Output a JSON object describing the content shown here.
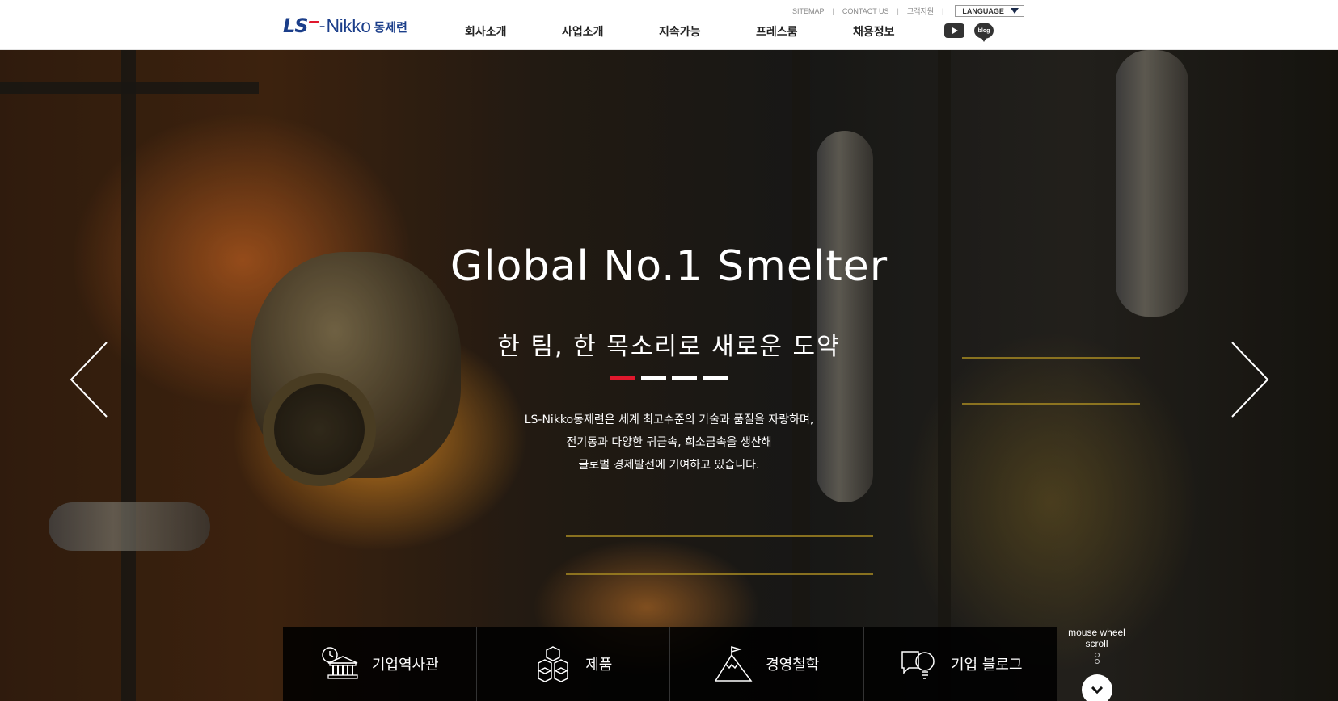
{
  "header": {
    "logo": {
      "ls": "LS",
      "dash": "-",
      "nikko": "Nikko",
      "korean": "동제련"
    },
    "util_links": [
      "SITEMAP",
      "CONTACT US",
      "고객지원"
    ],
    "language_label": "LANGUAGE",
    "nav": [
      "회사소개",
      "사업소개",
      "지속가능",
      "프레스룸",
      "채용정보"
    ],
    "sns": {
      "youtube": "youtube-icon",
      "blog": "blog"
    }
  },
  "hero": {
    "title": "Global No.1 Smelter",
    "subtitle": "한 팀, 한 목소리로 새로운 도약",
    "slides_total": 4,
    "active_slide": 1,
    "description": [
      "LS-Nikko동제련은 세계 최고수준의 기술과 품질을 자랑하며,",
      "전기동과 다양한 귀금속, 희소금속을 생산해",
      "글로벌 경제발전에 기여하고 있습니다."
    ]
  },
  "quick_menu": [
    {
      "label": "기업역사관",
      "icon": "history-museum-icon"
    },
    {
      "label": "제품",
      "icon": "product-cubes-icon"
    },
    {
      "label": "경영철학",
      "icon": "mountain-flag-icon"
    },
    {
      "label": "기업 블로그",
      "icon": "blog-chat-bulb-icon"
    }
  ],
  "scroll_hint": {
    "line1": "mouse wheel",
    "line2": "scroll"
  },
  "colors": {
    "brand_blue": "#1b3e8a",
    "accent_red": "#e0182d"
  }
}
